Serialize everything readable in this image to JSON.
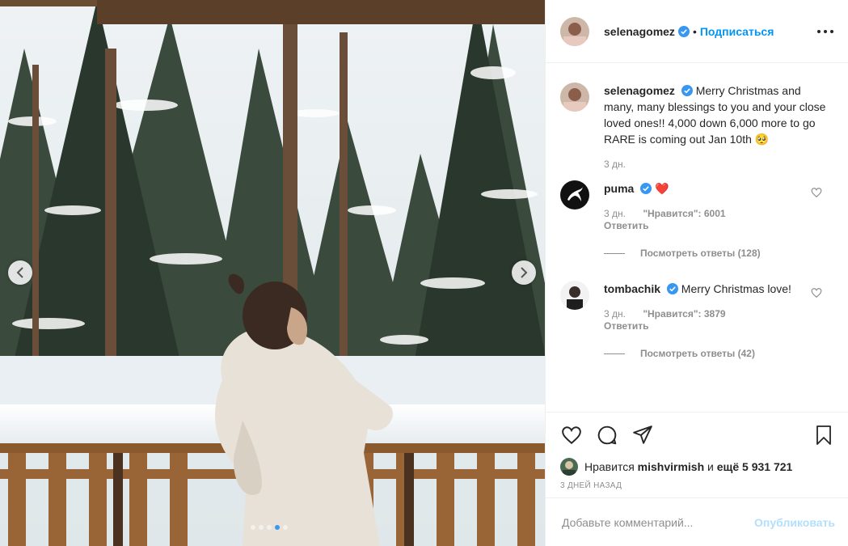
{
  "post": {
    "author": {
      "username": "selenagomez",
      "follow_label": "Подписаться",
      "bullet": "•"
    },
    "caption": {
      "username": "selenagomez",
      "text": "Merry Christmas and many, many blessings to you and your close loved ones!! 4,000 down 6,000 more to go RARE is coming out Jan 10th 🥺",
      "time": "3 дн."
    },
    "comments": [
      {
        "username": "puma",
        "text": "❤️",
        "time": "3 дн.",
        "likes": "\"Нравится\": 6001",
        "reply_label": "Ответить",
        "view_replies": "Посмотреть ответы (128)"
      },
      {
        "username": "tombachik",
        "text": "Merry Christmas love!",
        "time": "3 дн.",
        "likes": "\"Нравится\": 3879",
        "reply_label": "Ответить",
        "view_replies": "Посмотреть ответы (42)"
      }
    ],
    "likes": {
      "prefix": "Нравится",
      "user": "mishvirmish",
      "and": "и",
      "others": "ещё 5 931 721"
    },
    "date": "3 ДНЕЙ НАЗАД",
    "add_comment": {
      "placeholder": "Добавьте комментарий...",
      "publish_label": "Опубликовать"
    },
    "carousel": {
      "slide_count": 5,
      "active_index": 3
    }
  },
  "colors": {
    "verified": "#3897f0",
    "follow": "#0095f6",
    "publish_disabled": "#b2dffc",
    "heart": "#ed4956"
  },
  "icons": {
    "more": "more-horizontal-icon",
    "like": "heart-icon",
    "comment": "comment-bubble-icon",
    "share": "paper-plane-icon",
    "save": "bookmark-icon",
    "prev": "chevron-left-icon",
    "next": "chevron-right-icon"
  }
}
